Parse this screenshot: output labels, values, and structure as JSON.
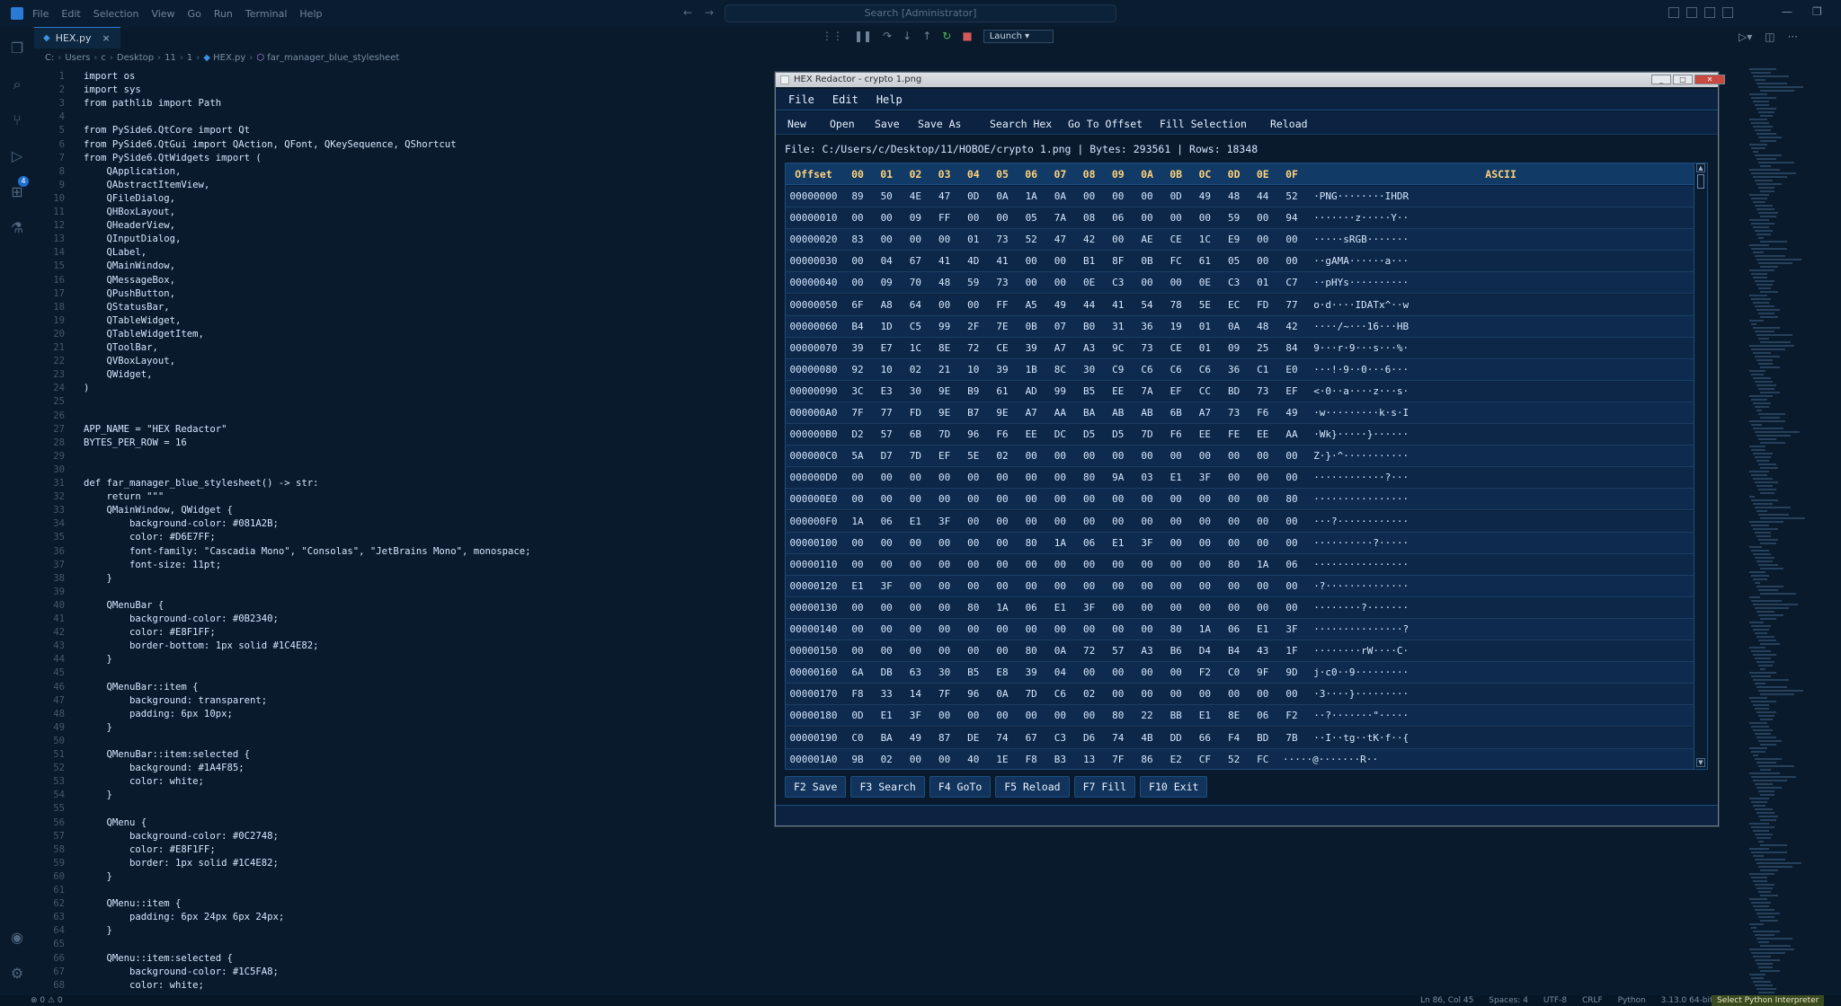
{
  "vscode": {
    "menu": [
      "File",
      "Edit",
      "Selection",
      "View",
      "Go",
      "Run",
      "Terminal",
      "Help"
    ],
    "search_placeholder": "Search [Administrator]",
    "tab_label": "HEX.py",
    "tab_close": "×",
    "launch_label": "Launch",
    "breadcrumbs": [
      "C:",
      "Users",
      "c",
      "Desktop",
      "11",
      "1",
      "HEX.py",
      "far_manager_blue_stylesheet"
    ],
    "status": {
      "errors": "⊗ 0 ⚠ 0",
      "position": "Ln 86, Col 45",
      "spaces": "Spaces: 4",
      "encoding": "UTF-8",
      "eol": "CRLF",
      "language": "Python",
      "version": "3.13.0 64-bit (system)",
      "interpreter": "Select Python Interpreter"
    },
    "code_lines": [
      "import os",
      "import sys",
      "from pathlib import Path",
      "",
      "from PySide6.QtCore import Qt",
      "from PySide6.QtGui import QAction, QFont, QKeySequence, QShortcut",
      "from PySide6.QtWidgets import (",
      "    QApplication,",
      "    QAbstractItemView,",
      "    QFileDialog,",
      "    QHBoxLayout,",
      "    QHeaderView,",
      "    QInputDialog,",
      "    QLabel,",
      "    QMainWindow,",
      "    QMessageBox,",
      "    QPushButton,",
      "    QStatusBar,",
      "    QTableWidget,",
      "    QTableWidgetItem,",
      "    QToolBar,",
      "    QVBoxLayout,",
      "    QWidget,",
      ")",
      "",
      "",
      "APP_NAME = \"HEX Redactor\"",
      "BYTES_PER_ROW = 16",
      "",
      "",
      "def far_manager_blue_stylesheet() -> str:",
      "    return \"\"\"",
      "    QMainWindow, QWidget {",
      "        background-color: #081A2B;",
      "        color: #D6E7FF;",
      "        font-family: \"Cascadia Mono\", \"Consolas\", \"JetBrains Mono\", monospace;",
      "        font-size: 11pt;",
      "    }",
      "",
      "    QMenuBar {",
      "        background-color: #0B2340;",
      "        color: #E8F1FF;",
      "        border-bottom: 1px solid #1C4E82;",
      "    }",
      "",
      "    QMenuBar::item {",
      "        background: transparent;",
      "        padding: 6px 10px;",
      "    }",
      "",
      "    QMenuBar::item:selected {",
      "        background: #1A4F85;",
      "        color: white;",
      "    }",
      "",
      "    QMenu {",
      "        background-color: #0C2748;",
      "        color: #E8F1FF;",
      "        border: 1px solid #1C4E82;",
      "    }",
      "",
      "    QMenu::item {",
      "        padding: 6px 24px 6px 24px;",
      "    }",
      "",
      "    QMenu::item:selected {",
      "        background-color: #1C5FA8;",
      "        color: white;"
    ]
  },
  "hex_window": {
    "title": "HEX Redactor - crypto 1.png",
    "title_buttons": [
      "_",
      "□",
      "✕"
    ],
    "menu": [
      "File",
      "Edit",
      "Help"
    ],
    "toolbar": [
      "New",
      "Open",
      "Save",
      "Save As",
      "Search Hex",
      "Go To Offset",
      "Fill Selection",
      "Reload"
    ],
    "file_info": "File: C:/Users/c/Desktop/11/HOBOE/crypto 1.png | Bytes: 293561 | Rows: 18348",
    "columns": [
      "Offset",
      "00",
      "01",
      "02",
      "03",
      "04",
      "05",
      "06",
      "07",
      "08",
      "09",
      "0A",
      "0B",
      "0C",
      "0D",
      "0E",
      "0F",
      "ASCII"
    ],
    "rows": [
      [
        "00000000",
        "89",
        "50",
        "4E",
        "47",
        "0D",
        "0A",
        "1A",
        "0A",
        "00",
        "00",
        "00",
        "0D",
        "49",
        "48",
        "44",
        "52",
        "·PNG········IHDR"
      ],
      [
        "00000010",
        "00",
        "00",
        "09",
        "FF",
        "00",
        "00",
        "05",
        "7A",
        "08",
        "06",
        "00",
        "00",
        "00",
        "59",
        "00",
        "94",
        "·······z·····Y··"
      ],
      [
        "00000020",
        "83",
        "00",
        "00",
        "00",
        "01",
        "73",
        "52",
        "47",
        "42",
        "00",
        "AE",
        "CE",
        "1C",
        "E9",
        "00",
        "00",
        "·····sRGB·······"
      ],
      [
        "00000030",
        "00",
        "04",
        "67",
        "41",
        "4D",
        "41",
        "00",
        "00",
        "B1",
        "8F",
        "0B",
        "FC",
        "61",
        "05",
        "00",
        "00",
        "··gAMA······a···"
      ],
      [
        "00000040",
        "00",
        "09",
        "70",
        "48",
        "59",
        "73",
        "00",
        "00",
        "0E",
        "C3",
        "00",
        "00",
        "0E",
        "C3",
        "01",
        "C7",
        "··pHYs··········"
      ],
      [
        "00000050",
        "6F",
        "A8",
        "64",
        "00",
        "00",
        "FF",
        "A5",
        "49",
        "44",
        "41",
        "54",
        "78",
        "5E",
        "EC",
        "FD",
        "77",
        "o·d····IDATx^··w"
      ],
      [
        "00000060",
        "B4",
        "1D",
        "C5",
        "99",
        "2F",
        "7E",
        "0B",
        "07",
        "B0",
        "31",
        "36",
        "19",
        "01",
        "0A",
        "48",
        "42",
        "····/~···16···HB"
      ],
      [
        "00000070",
        "39",
        "E7",
        "1C",
        "8E",
        "72",
        "CE",
        "39",
        "A7",
        "A3",
        "9C",
        "73",
        "CE",
        "01",
        "09",
        "25",
        "84",
        "9···r·9···s···%·"
      ],
      [
        "00000080",
        "92",
        "10",
        "02",
        "21",
        "10",
        "39",
        "1B",
        "8C",
        "30",
        "C9",
        "C6",
        "C6",
        "C6",
        "36",
        "C1",
        "E0",
        "···!·9··0···6···"
      ],
      [
        "00000090",
        "3C",
        "E3",
        "30",
        "9E",
        "B9",
        "61",
        "AD",
        "99",
        "B5",
        "EE",
        "7A",
        "EF",
        "CC",
        "BD",
        "73",
        "EF",
        "<·0··a····z···s·"
      ],
      [
        "000000A0",
        "7F",
        "77",
        "FD",
        "9E",
        "B7",
        "9E",
        "A7",
        "AA",
        "BA",
        "AB",
        "AB",
        "6B",
        "A7",
        "73",
        "F6",
        "49",
        "·w·········k·s·I"
      ],
      [
        "000000B0",
        "D2",
        "57",
        "6B",
        "7D",
        "96",
        "F6",
        "EE",
        "DC",
        "D5",
        "D5",
        "7D",
        "F6",
        "EE",
        "FE",
        "EE",
        "AA",
        "·Wk}·····}······"
      ],
      [
        "000000C0",
        "5A",
        "D7",
        "7D",
        "EF",
        "5E",
        "02",
        "00",
        "00",
        "00",
        "00",
        "00",
        "00",
        "00",
        "00",
        "00",
        "00",
        "Z·}·^···········"
      ],
      [
        "000000D0",
        "00",
        "00",
        "00",
        "00",
        "00",
        "00",
        "00",
        "00",
        "80",
        "9A",
        "03",
        "E1",
        "3F",
        "00",
        "00",
        "00",
        "············?···"
      ],
      [
        "000000E0",
        "00",
        "00",
        "00",
        "00",
        "00",
        "00",
        "00",
        "00",
        "00",
        "00",
        "00",
        "00",
        "00",
        "00",
        "00",
        "80",
        "················"
      ],
      [
        "000000F0",
        "1A",
        "06",
        "E1",
        "3F",
        "00",
        "00",
        "00",
        "00",
        "00",
        "00",
        "00",
        "00",
        "00",
        "00",
        "00",
        "00",
        "···?············"
      ],
      [
        "00000100",
        "00",
        "00",
        "00",
        "00",
        "00",
        "00",
        "80",
        "1A",
        "06",
        "E1",
        "3F",
        "00",
        "00",
        "00",
        "00",
        "00",
        "··········?·····"
      ],
      [
        "00000110",
        "00",
        "00",
        "00",
        "00",
        "00",
        "00",
        "00",
        "00",
        "00",
        "00",
        "00",
        "00",
        "00",
        "80",
        "1A",
        "06",
        "················"
      ],
      [
        "00000120",
        "E1",
        "3F",
        "00",
        "00",
        "00",
        "00",
        "00",
        "00",
        "00",
        "00",
        "00",
        "00",
        "00",
        "00",
        "00",
        "00",
        "·?··············"
      ],
      [
        "00000130",
        "00",
        "00",
        "00",
        "00",
        "80",
        "1A",
        "06",
        "E1",
        "3F",
        "00",
        "00",
        "00",
        "00",
        "00",
        "00",
        "00",
        "········?·······"
      ],
      [
        "00000140",
        "00",
        "00",
        "00",
        "00",
        "00",
        "00",
        "00",
        "00",
        "00",
        "00",
        "00",
        "80",
        "1A",
        "06",
        "E1",
        "3F",
        "···············?"
      ],
      [
        "00000150",
        "00",
        "00",
        "00",
        "00",
        "00",
        "00",
        "80",
        "0A",
        "72",
        "57",
        "A3",
        "B6",
        "D4",
        "B4",
        "43",
        "1F",
        "········rW····C·"
      ],
      [
        "00000160",
        "6A",
        "DB",
        "63",
        "30",
        "B5",
        "E8",
        "39",
        "04",
        "00",
        "00",
        "00",
        "00",
        "F2",
        "C0",
        "9F",
        "9D",
        "j·c0··9·········"
      ],
      [
        "00000170",
        "F8",
        "33",
        "14",
        "7F",
        "96",
        "0A",
        "7D",
        "C6",
        "02",
        "00",
        "00",
        "00",
        "00",
        "00",
        "00",
        "00",
        "·3····}·········"
      ],
      [
        "00000180",
        "0D",
        "E1",
        "3F",
        "00",
        "00",
        "00",
        "00",
        "00",
        "00",
        "80",
        "22",
        "BB",
        "E1",
        "8E",
        "06",
        "F2",
        "··?·······\"·····"
      ],
      [
        "00000190",
        "C0",
        "BA",
        "49",
        "87",
        "DE",
        "74",
        "67",
        "C3",
        "D6",
        "74",
        "4B",
        "DD",
        "66",
        "F4",
        "BD",
        "7B",
        "··I··tg··tK·f··{"
      ],
      [
        "000001A0",
        "9B",
        "02",
        "00",
        "00",
        "40",
        "1E",
        "F8",
        "B3",
        "13",
        "7F",
        "86",
        "E2",
        "CF",
        "52",
        "FC",
        "·····@·······R··"
      ]
    ],
    "fkeys": [
      "F2 Save",
      "F3 Search",
      "F4 GoTo",
      "F5 Reload",
      "F7 Fill",
      "F10 Exit"
    ]
  }
}
